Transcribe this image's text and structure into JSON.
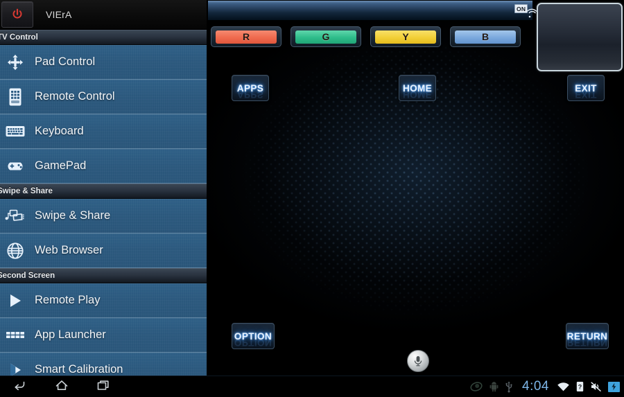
{
  "app": {
    "title": "VIErA",
    "power_icon": "power-icon"
  },
  "sidebar": {
    "sections": [
      {
        "title": "TV Control",
        "items": [
          {
            "label": "Pad Control",
            "icon": "dpad-icon"
          },
          {
            "label": "Remote Control",
            "icon": "remote-control-icon"
          },
          {
            "label": "Keyboard",
            "icon": "keyboard-icon"
          },
          {
            "label": "GamePad",
            "icon": "gamepad-icon"
          }
        ]
      },
      {
        "title": "Swipe & Share",
        "items": [
          {
            "label": "Swipe & Share",
            "icon": "swipe-share-icon"
          },
          {
            "label": "Web Browser",
            "icon": "globe-icon"
          }
        ]
      },
      {
        "title": "Second Screen",
        "items": [
          {
            "label": "Remote Play",
            "icon": "play-icon"
          },
          {
            "label": "App Launcher",
            "icon": "app-grid-icon"
          },
          {
            "label": "Smart Calibration",
            "icon": "calibration-icon"
          }
        ]
      }
    ]
  },
  "main": {
    "connection": {
      "state": "ON",
      "icon": "wifi-signal-icon"
    },
    "color_keys": [
      {
        "label": "R",
        "color": "#ef6a4e"
      },
      {
        "label": "G",
        "color": "#2ebc8a"
      },
      {
        "label": "Y",
        "color": "#f2cf36"
      },
      {
        "label": "B",
        "color": "#7aa8dd"
      }
    ],
    "buttons": {
      "apps": "APPS",
      "home": "HOME",
      "exit": "EXIT",
      "option": "OPTION",
      "return": "RETURN"
    },
    "voice": {
      "icon": "microphone-icon"
    }
  },
  "statusbar": {
    "nav": [
      {
        "name": "back",
        "icon": "back-arrow-icon"
      },
      {
        "name": "home",
        "icon": "home-icon"
      },
      {
        "name": "recents",
        "icon": "recents-icon"
      }
    ],
    "time": "4:04",
    "icons": [
      {
        "name": "eye-icon"
      },
      {
        "name": "android-robot-icon"
      },
      {
        "name": "usb-icon"
      },
      {
        "name": "wifi-icon"
      },
      {
        "name": "sim-unknown-icon"
      },
      {
        "name": "mute-icon"
      },
      {
        "name": "battery-charging-icon"
      }
    ]
  }
}
